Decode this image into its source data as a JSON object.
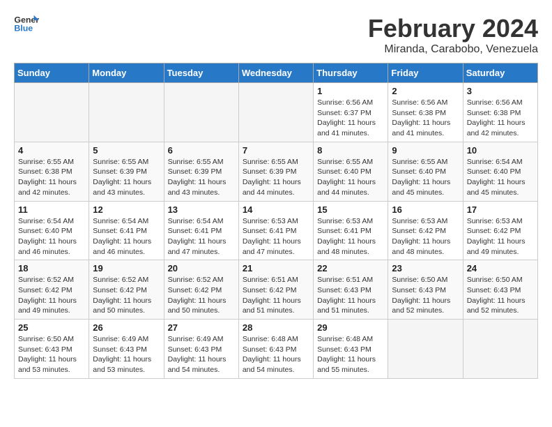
{
  "logo": {
    "line1": "General",
    "line2": "Blue"
  },
  "title": "February 2024",
  "subtitle": "Miranda, Carabobo, Venezuela",
  "days_of_week": [
    "Sunday",
    "Monday",
    "Tuesday",
    "Wednesday",
    "Thursday",
    "Friday",
    "Saturday"
  ],
  "weeks": [
    [
      {
        "day": "",
        "sunrise": "",
        "sunset": "",
        "daylight": ""
      },
      {
        "day": "",
        "sunrise": "",
        "sunset": "",
        "daylight": ""
      },
      {
        "day": "",
        "sunrise": "",
        "sunset": "",
        "daylight": ""
      },
      {
        "day": "",
        "sunrise": "",
        "sunset": "",
        "daylight": ""
      },
      {
        "day": "1",
        "sunrise": "Sunrise: 6:56 AM",
        "sunset": "Sunset: 6:37 PM",
        "daylight": "Daylight: 11 hours and 41 minutes."
      },
      {
        "day": "2",
        "sunrise": "Sunrise: 6:56 AM",
        "sunset": "Sunset: 6:38 PM",
        "daylight": "Daylight: 11 hours and 41 minutes."
      },
      {
        "day": "3",
        "sunrise": "Sunrise: 6:56 AM",
        "sunset": "Sunset: 6:38 PM",
        "daylight": "Daylight: 11 hours and 42 minutes."
      }
    ],
    [
      {
        "day": "4",
        "sunrise": "Sunrise: 6:55 AM",
        "sunset": "Sunset: 6:38 PM",
        "daylight": "Daylight: 11 hours and 42 minutes."
      },
      {
        "day": "5",
        "sunrise": "Sunrise: 6:55 AM",
        "sunset": "Sunset: 6:39 PM",
        "daylight": "Daylight: 11 hours and 43 minutes."
      },
      {
        "day": "6",
        "sunrise": "Sunrise: 6:55 AM",
        "sunset": "Sunset: 6:39 PM",
        "daylight": "Daylight: 11 hours and 43 minutes."
      },
      {
        "day": "7",
        "sunrise": "Sunrise: 6:55 AM",
        "sunset": "Sunset: 6:39 PM",
        "daylight": "Daylight: 11 hours and 44 minutes."
      },
      {
        "day": "8",
        "sunrise": "Sunrise: 6:55 AM",
        "sunset": "Sunset: 6:40 PM",
        "daylight": "Daylight: 11 hours and 44 minutes."
      },
      {
        "day": "9",
        "sunrise": "Sunrise: 6:55 AM",
        "sunset": "Sunset: 6:40 PM",
        "daylight": "Daylight: 11 hours and 45 minutes."
      },
      {
        "day": "10",
        "sunrise": "Sunrise: 6:54 AM",
        "sunset": "Sunset: 6:40 PM",
        "daylight": "Daylight: 11 hours and 45 minutes."
      }
    ],
    [
      {
        "day": "11",
        "sunrise": "Sunrise: 6:54 AM",
        "sunset": "Sunset: 6:40 PM",
        "daylight": "Daylight: 11 hours and 46 minutes."
      },
      {
        "day": "12",
        "sunrise": "Sunrise: 6:54 AM",
        "sunset": "Sunset: 6:41 PM",
        "daylight": "Daylight: 11 hours and 46 minutes."
      },
      {
        "day": "13",
        "sunrise": "Sunrise: 6:54 AM",
        "sunset": "Sunset: 6:41 PM",
        "daylight": "Daylight: 11 hours and 47 minutes."
      },
      {
        "day": "14",
        "sunrise": "Sunrise: 6:53 AM",
        "sunset": "Sunset: 6:41 PM",
        "daylight": "Daylight: 11 hours and 47 minutes."
      },
      {
        "day": "15",
        "sunrise": "Sunrise: 6:53 AM",
        "sunset": "Sunset: 6:41 PM",
        "daylight": "Daylight: 11 hours and 48 minutes."
      },
      {
        "day": "16",
        "sunrise": "Sunrise: 6:53 AM",
        "sunset": "Sunset: 6:42 PM",
        "daylight": "Daylight: 11 hours and 48 minutes."
      },
      {
        "day": "17",
        "sunrise": "Sunrise: 6:53 AM",
        "sunset": "Sunset: 6:42 PM",
        "daylight": "Daylight: 11 hours and 49 minutes."
      }
    ],
    [
      {
        "day": "18",
        "sunrise": "Sunrise: 6:52 AM",
        "sunset": "Sunset: 6:42 PM",
        "daylight": "Daylight: 11 hours and 49 minutes."
      },
      {
        "day": "19",
        "sunrise": "Sunrise: 6:52 AM",
        "sunset": "Sunset: 6:42 PM",
        "daylight": "Daylight: 11 hours and 50 minutes."
      },
      {
        "day": "20",
        "sunrise": "Sunrise: 6:52 AM",
        "sunset": "Sunset: 6:42 PM",
        "daylight": "Daylight: 11 hours and 50 minutes."
      },
      {
        "day": "21",
        "sunrise": "Sunrise: 6:51 AM",
        "sunset": "Sunset: 6:42 PM",
        "daylight": "Daylight: 11 hours and 51 minutes."
      },
      {
        "day": "22",
        "sunrise": "Sunrise: 6:51 AM",
        "sunset": "Sunset: 6:43 PM",
        "daylight": "Daylight: 11 hours and 51 minutes."
      },
      {
        "day": "23",
        "sunrise": "Sunrise: 6:50 AM",
        "sunset": "Sunset: 6:43 PM",
        "daylight": "Daylight: 11 hours and 52 minutes."
      },
      {
        "day": "24",
        "sunrise": "Sunrise: 6:50 AM",
        "sunset": "Sunset: 6:43 PM",
        "daylight": "Daylight: 11 hours and 52 minutes."
      }
    ],
    [
      {
        "day": "25",
        "sunrise": "Sunrise: 6:50 AM",
        "sunset": "Sunset: 6:43 PM",
        "daylight": "Daylight: 11 hours and 53 minutes."
      },
      {
        "day": "26",
        "sunrise": "Sunrise: 6:49 AM",
        "sunset": "Sunset: 6:43 PM",
        "daylight": "Daylight: 11 hours and 53 minutes."
      },
      {
        "day": "27",
        "sunrise": "Sunrise: 6:49 AM",
        "sunset": "Sunset: 6:43 PM",
        "daylight": "Daylight: 11 hours and 54 minutes."
      },
      {
        "day": "28",
        "sunrise": "Sunrise: 6:48 AM",
        "sunset": "Sunset: 6:43 PM",
        "daylight": "Daylight: 11 hours and 54 minutes."
      },
      {
        "day": "29",
        "sunrise": "Sunrise: 6:48 AM",
        "sunset": "Sunset: 6:43 PM",
        "daylight": "Daylight: 11 hours and 55 minutes."
      },
      {
        "day": "",
        "sunrise": "",
        "sunset": "",
        "daylight": ""
      },
      {
        "day": "",
        "sunrise": "",
        "sunset": "",
        "daylight": ""
      }
    ]
  ]
}
